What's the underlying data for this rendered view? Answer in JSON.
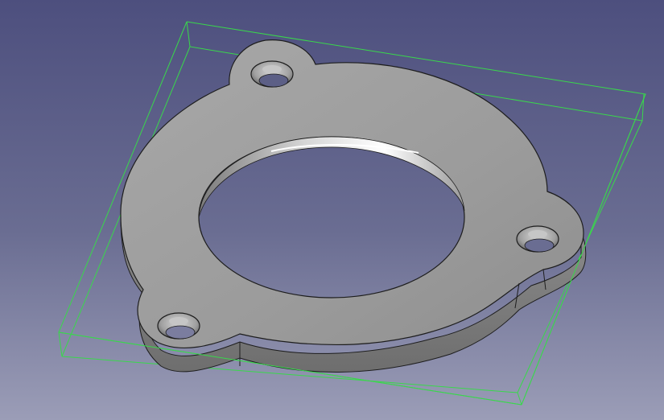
{
  "viewport": {
    "name": "3d-view",
    "object": "flange-plate",
    "bounding_box_visible": true,
    "selection_highlight": false
  },
  "colors": {
    "background_top": "#4d4f7e",
    "background_bottom": "#9b9db7",
    "bounding_box": "#39d84b",
    "part_top_face": "#9e9e9e",
    "part_side_face": "#7c7c7c",
    "edge_lines": "#1d1d1d"
  }
}
